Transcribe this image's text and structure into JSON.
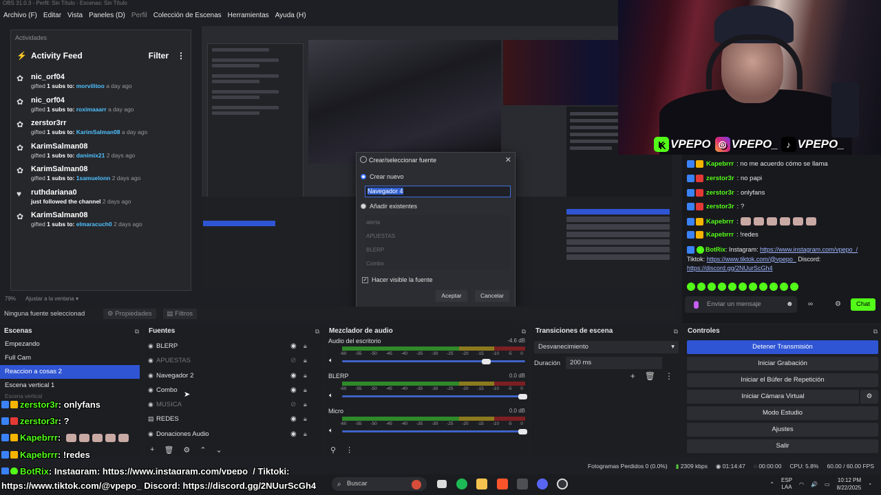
{
  "window_title": "OBS 31.0.3 - Perfil: Sin Título - Escenas: Sin Título",
  "menu": [
    "Archivo (F)",
    "Editar",
    "Vista",
    "Paneles (D)",
    "Perfil",
    "Colección de Escenas",
    "Herramientas",
    "Ayuda (H)"
  ],
  "activity": {
    "panel_title": "Actividades",
    "header": "Activity Feed",
    "filter": "Filter",
    "items": [
      {
        "name": "nic_orf04",
        "pre": "gifted",
        "count": "1",
        "mid": "subs",
        "to": "to:",
        "target": "morvilitoo",
        "ago": "a day ago"
      },
      {
        "name": "nic_orf04",
        "pre": "gifted",
        "count": "1",
        "mid": "subs",
        "to": "to:",
        "target": "roximaaarr",
        "ago": "a day ago"
      },
      {
        "name": "zerstor3rr",
        "pre": "gifted",
        "count": "1",
        "mid": "subs",
        "to": "to:",
        "target": "KarimSalman08",
        "ago": "a day ago"
      },
      {
        "name": "KarimSalman08",
        "pre": "gifted",
        "count": "1",
        "mid": "subs",
        "to": "to:",
        "target": "danimix21",
        "ago": "2 days ago"
      },
      {
        "name": "KarimSalman08",
        "pre": "gifted",
        "count": "1",
        "mid": "subs",
        "to": "to:",
        "target": "1samuelonn",
        "ago": "2 days ago"
      },
      {
        "name": "ruthdariana0",
        "pre": "just followed the channel",
        "count": "",
        "mid": "",
        "to": "",
        "target": "",
        "ago": "2 days ago"
      },
      {
        "name": "KarimSalman08",
        "pre": "gifted",
        "count": "1",
        "mid": "subs",
        "to": "to:",
        "target": "elmaracuch0",
        "ago": "2 days ago"
      }
    ]
  },
  "dialog": {
    "title": "Crear/seleccionar fuente",
    "create_new": "Crear nuevo",
    "name_value": "Navegador 4",
    "add_existing": "Añadir existentes",
    "existing": [
      "alerta",
      "APUESTAS",
      "BLERP",
      "Combo"
    ],
    "make_visible": "Hacer visible la fuente",
    "accept": "Aceptar",
    "cancel": "Cancelar"
  },
  "socials": {
    "kick": "VPEPO",
    "instagram": "VPEPO_",
    "tiktok": "VPEPO_"
  },
  "chat": {
    "messages": [
      {
        "user": "Kapebrrr",
        "text": "no me acuerdo cómo se llama",
        "color": "#53fc18"
      },
      {
        "user": "zerstor3r",
        "text": "no papi",
        "color": "#53fc18"
      },
      {
        "user": "zerstor3r",
        "text": "onlyfans",
        "color": "#53fc18"
      },
      {
        "user": "zerstor3r",
        "text": "?",
        "color": "#53fc18"
      },
      {
        "user": "Kapebrrr",
        "text": "",
        "color": "#53fc18"
      },
      {
        "user": "Kapebrrr",
        "text": "!redes",
        "color": "#53fc18"
      }
    ],
    "bot_user": "BotRix",
    "bot_text_1": "Instagram:",
    "bot_link_ig": "https://www.instagram.com/vpepo_/",
    "bot_text_2": "Tiktok:",
    "bot_link_tt": "https://www.tiktok.com/@vpepo_",
    "bot_text_3": "Discord:",
    "bot_link_dc": "https://discord.gg/2NUurScGh4",
    "input_placeholder": "Enviar un mensaje",
    "send": "Chat"
  },
  "preview_bar": {
    "zoom": "79%",
    "fit": "Ajustar a la ventana"
  },
  "toolbar": {
    "no_source": "Ninguna fuente seleccionad",
    "properties": "Propiedades",
    "filters": "Filtros"
  },
  "scenes": {
    "title": "Escenas",
    "items": [
      "Empezando",
      "Full Cam",
      "Reaccion a cosas 2",
      "Escena vertical 1",
      "Escena vertical"
    ],
    "selected_index": 2
  },
  "sources": {
    "title": "Fuentes",
    "items": [
      {
        "name": "BLERP",
        "visible": true
      },
      {
        "name": "APUESTAS",
        "visible": false
      },
      {
        "name": "Navegador 2",
        "visible": true
      },
      {
        "name": "Combo",
        "visible": true
      },
      {
        "name": "MUSICA",
        "visible": false
      },
      {
        "name": "REDES",
        "visible": true
      },
      {
        "name": "Donaciones Audio",
        "visible": true
      }
    ]
  },
  "mixer": {
    "title": "Mezclador de audio",
    "ticks": [
      "-60",
      "-55",
      "-50",
      "-45",
      "-40",
      "-35",
      "-30",
      "-25",
      "-20",
      "-15",
      "-10",
      "-5",
      "0"
    ],
    "channels": [
      {
        "name": "Audio del escritorio",
        "db": "-4.6 dB",
        "volume": 0.8
      },
      {
        "name": "BLERP",
        "db": "0.0 dB",
        "volume": 1.0
      },
      {
        "name": "Micro",
        "db": "0.0 dB",
        "volume": 1.0
      }
    ]
  },
  "transitions": {
    "title": "Transiciones de escena",
    "selected": "Desvanecimiento",
    "duration_label": "Duración",
    "duration": "200 ms"
  },
  "controls": {
    "title": "Controles",
    "buttons": [
      "Detener Transmisión",
      "Iniciar Grabación",
      "Iniciar el Búfer de Repetición",
      "Iniciar Cámara Virtual",
      "Modo Estudio",
      "Ajustes",
      "Salir"
    ]
  },
  "overlay_chat": {
    "line1_user": "zerstor3r",
    "line1_text": ": onlyfans",
    "line2_user": "zerstor3r",
    "line2_text": ": ?",
    "line3_user": "Kapebrrr",
    "line3_text": ":",
    "line4_user": "Kapebrrr",
    "line4_text": ": !redes",
    "line5_user": "BotRix",
    "line5_text": ": Instagram: https://www.instagram.com/vpepo_/ Tiktoki:",
    "line6_text": "https://www.tiktok.com/@vpepo_ Discord: https://discord.gg/2NUurScGh4"
  },
  "status": {
    "dropped": "Fotogramas Perdidos 0 (0.0%)",
    "bitrate": "2309 kbps",
    "live_time": "01:14:47",
    "rec_time": "00:00:00",
    "cpu": "CPU: 5.8%",
    "fps": "60.00 / 60.00 FPS"
  },
  "taskbar": {
    "search": "Buscar",
    "lang": "ESP",
    "lang2": "LAA",
    "time": "10:12 PM",
    "date": "8/22/2025"
  }
}
